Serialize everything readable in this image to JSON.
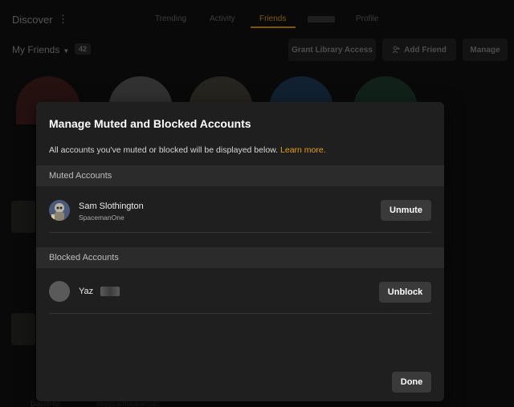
{
  "header": {
    "brand": "Discover",
    "kebab_icon": "⋮",
    "tabs": [
      {
        "label": "Trending"
      },
      {
        "label": "Activity"
      },
      {
        "label": "Friends",
        "active": true
      },
      {
        "label": ""
      },
      {
        "label": "Profile"
      }
    ]
  },
  "friends": {
    "dropdown_label": "My Friends",
    "caret_icon": "▼",
    "count": "42",
    "grant_label": "Grant Library Access",
    "add_icon": "person-add-icon",
    "add_label": "Add Friend",
    "manage_label": "Manage"
  },
  "background_bottom": [
    "DavidHM",
    "deepcanhisanero4c"
  ],
  "modal": {
    "title": "Manage Muted and Blocked Accounts",
    "description": "All accounts you've muted or blocked will be displayed below.",
    "learn_more": "Learn more.",
    "muted_section": "Muted Accounts",
    "muted": [
      {
        "name": "Sam Slothington",
        "username": "SpacemanOne",
        "button": "Unmute"
      }
    ],
    "blocked_section": "Blocked Accounts",
    "blocked": [
      {
        "name": "Yaz",
        "button": "Unblock"
      }
    ],
    "done_label": "Done"
  },
  "colors": {
    "accent": "#e5a00d",
    "modal_bg": "#1f1f1f",
    "section_bg": "#2b2b2b",
    "button_bg": "#3a3a3a"
  }
}
